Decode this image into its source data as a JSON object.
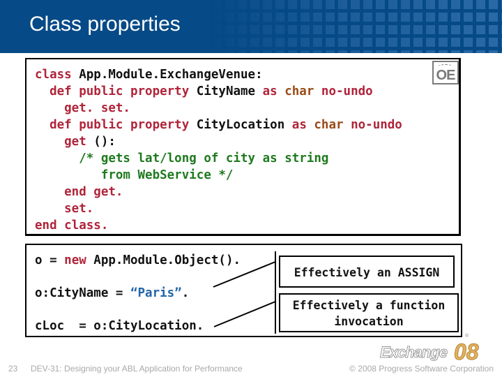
{
  "header": {
    "title": "Class properties"
  },
  "class_code": {
    "lines": [
      [
        {
          "t": "class",
          "k": "kw"
        },
        {
          "t": " App.Module.ExchangeVenue:",
          "k": ""
        }
      ],
      [
        {
          "t": "  def public property",
          "k": "kw"
        },
        {
          "t": " CityName ",
          "k": ""
        },
        {
          "t": "as",
          "k": "kw"
        },
        {
          "t": " char",
          "k": "ty"
        },
        {
          "t": " no-undo",
          "k": "kw"
        }
      ],
      [
        {
          "t": "    get. set.",
          "k": "kw"
        }
      ],
      [
        {
          "t": "  def public property",
          "k": "kw"
        },
        {
          "t": " CityLocation ",
          "k": ""
        },
        {
          "t": "as",
          "k": "kw"
        },
        {
          "t": " char",
          "k": "ty"
        },
        {
          "t": " no-undo",
          "k": "kw"
        }
      ],
      [
        {
          "t": "    get",
          "k": "kw"
        },
        {
          "t": " ():",
          "k": ""
        }
      ],
      [
        {
          "t": "      /* gets lat/long of city as string",
          "k": "cm"
        }
      ],
      [
        {
          "t": "         from WebService */",
          "k": "cm"
        }
      ],
      [
        {
          "t": "    end get.",
          "k": "kw"
        }
      ],
      [
        {
          "t": "    set.",
          "k": "kw"
        }
      ],
      [
        {
          "t": "end class.",
          "k": "kw"
        }
      ]
    ]
  },
  "usage_code": {
    "line1": [
      {
        "t": "o = ",
        "k": ""
      },
      {
        "t": "new",
        "k": "kw"
      },
      {
        "t": " App.Module.Object().",
        "k": ""
      }
    ],
    "line2": [
      {
        "t": "o:CityName = ",
        "k": ""
      },
      {
        "t": "“Paris”",
        "k": "st"
      },
      {
        "t": ".",
        "k": ""
      }
    ],
    "line3": [
      {
        "t": "cLoc  = o:CityLocation.",
        "k": ""
      }
    ]
  },
  "callouts": {
    "assign": "Effectively an ASSIGN",
    "function_line1": "Effectively a function",
    "function_line2": "invocation"
  },
  "logos": {
    "oe": "OE",
    "exchange_word": "Exchange",
    "exchange_year": "08",
    "registered": "®"
  },
  "footer": {
    "slide_number": "23",
    "talk_title": "DEV-31: Designing your ABL Application for Performance",
    "copyright": "© 2008 Progress Software Corporation"
  },
  "colors": {
    "header_bg": "#064a87",
    "keyword": "#b0243a",
    "type": "#9a4a16",
    "comment": "#1f7a1f",
    "string": "#2266aa",
    "footer_text": "#a8a8a8",
    "logo_gold": "#e3b15e"
  }
}
